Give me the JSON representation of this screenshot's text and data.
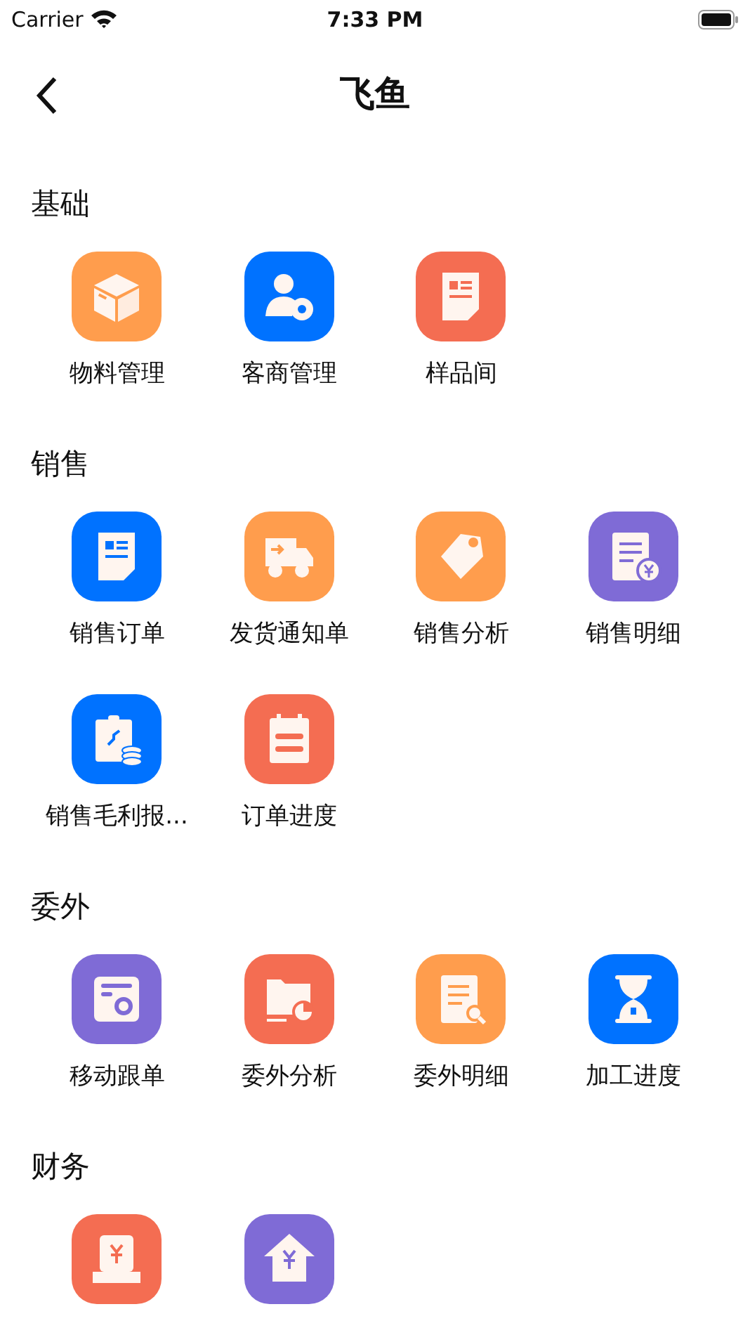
{
  "status_bar": {
    "carrier": "Carrier",
    "time": "7:33 PM"
  },
  "nav": {
    "title": "飞鱼"
  },
  "sections": [
    {
      "title": "基础",
      "items": [
        {
          "label": "物料管理",
          "kind": "box",
          "color": "#ff9d4d"
        },
        {
          "label": "客商管理",
          "kind": "user-gear",
          "color": "#0072ff"
        },
        {
          "label": "样品间",
          "kind": "document",
          "color": "#f46d52"
        }
      ]
    },
    {
      "title": "销售",
      "items": [
        {
          "label": "销售订单",
          "kind": "document",
          "color": "#0072ff"
        },
        {
          "label": "发货通知单",
          "kind": "truck",
          "color": "#ff9d4d"
        },
        {
          "label": "销售分析",
          "kind": "tag",
          "color": "#ff9d4d"
        },
        {
          "label": "销售明细",
          "kind": "doc-yen",
          "color": "#7f6bd6"
        },
        {
          "label": "销售毛利报...",
          "kind": "clipboard-coins",
          "color": "#0072ff"
        },
        {
          "label": "订单进度",
          "kind": "calendar-bars",
          "color": "#f46d52"
        }
      ]
    },
    {
      "title": "委外",
      "items": [
        {
          "label": "移动跟单",
          "kind": "form-target",
          "color": "#7f6bd6"
        },
        {
          "label": "委外分析",
          "kind": "folder-chart",
          "color": "#f46d52"
        },
        {
          "label": "委外明细",
          "kind": "doc-search",
          "color": "#ff9d4d"
        },
        {
          "label": "加工进度",
          "kind": "hourglass",
          "color": "#0072ff"
        }
      ]
    },
    {
      "title": "财务",
      "items": [
        {
          "kind": "yen-box",
          "color": "#f46d52"
        },
        {
          "kind": "house-yen",
          "color": "#7f6bd6"
        }
      ]
    }
  ]
}
